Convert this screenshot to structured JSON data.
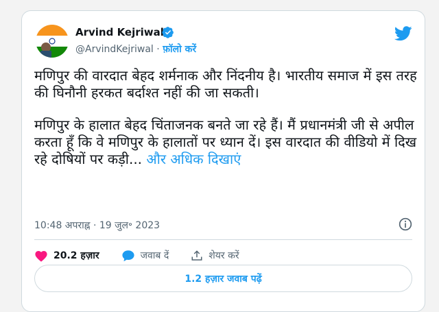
{
  "author": {
    "name": "Arvind Kejriwal",
    "handle": "@ArvindKejriwal",
    "separator": "·",
    "follow_label": "फ़ॉलो करें"
  },
  "tweet": {
    "paragraph1": "मणिपुर की वारदात बेहद शर्मनाक और निंदनीय है। भारतीय समाज में इस तरह की घिनौनी हरकत बर्दाश्त नहीं की जा सकती।",
    "paragraph2": "मणिपुर के हालात बेहद चिंताजनक बनते जा रहे हैं। मैं प्रधानमंत्री जी से अपील करता हूँ कि वे मणिपुर के हालातों पर ध्यान दें। इस वारदात की वीडियो में दिख रहे दोषियों पर कड़ी...",
    "show_more": "और अधिक दिखाएं"
  },
  "meta": {
    "timestamp": "10:48 अपराह्न · 19 जुल॰ 2023"
  },
  "actions": {
    "likes_count": "20.2 हज़ार",
    "reply_label": "जवाब दें",
    "share_label": "शेयर करें"
  },
  "read_replies_label": "1.2 हज़ार जवाब पढ़ें",
  "colors": {
    "accent": "#1d9bf0",
    "like": "#f91880",
    "muted": "#536471",
    "border": "#cfd9de"
  },
  "icons": [
    "verified-badge-icon",
    "twitter-bird-icon",
    "info-icon",
    "heart-icon",
    "reply-bubble-icon",
    "share-icon"
  ]
}
